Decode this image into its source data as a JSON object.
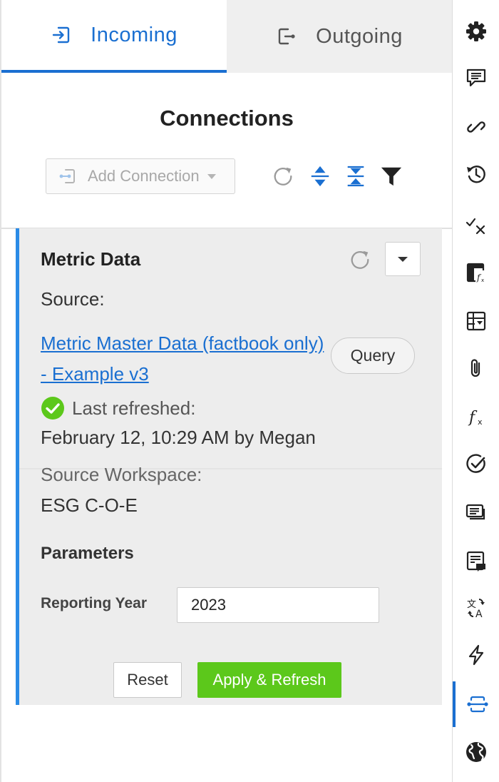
{
  "tabs": [
    {
      "label": "Incoming",
      "active": true,
      "icon": "incoming-icon"
    },
    {
      "label": "Outgoing",
      "active": false,
      "icon": "outgoing-icon"
    }
  ],
  "title": "Connections",
  "toolbar": {
    "add_connection_label": "Add Connection",
    "icons": [
      "refresh-icon",
      "expand-all-icon",
      "collapse-all-icon",
      "filter-icon"
    ]
  },
  "connection": {
    "name": "Metric Data",
    "source_label": "Source:",
    "source_link": "Metric Master Data (factbook only) - Example v3",
    "query_label": "Query",
    "last_refreshed_label": "Last refreshed:",
    "last_refreshed_value": "February 12, 10:29 AM by Megan",
    "source_workspace_label": "Source Workspace:",
    "source_workspace_value": "ESG C-O-E",
    "parameters_title": "Parameters",
    "parameters": [
      {
        "label": "Reporting Year",
        "value": "2023"
      }
    ],
    "reset_label": "Reset",
    "apply_label": "Apply & Refresh"
  },
  "sidebar": {
    "items": [
      "settings-icon",
      "comments-icon",
      "link-icon",
      "history-icon",
      "check-x-icon",
      "formula-table-icon",
      "table-dropdown-icon",
      "attachment-icon",
      "function-icon",
      "approval-icon",
      "cards-icon",
      "notes-icon",
      "translate-icon",
      "lightning-icon",
      "connections-icon",
      "globe-icon"
    ],
    "active": "connections-icon"
  },
  "colors": {
    "accent": "#1a6fd1",
    "card_border": "#2a8be6",
    "success": "#5cc81b",
    "card_bg": "#ededed"
  }
}
